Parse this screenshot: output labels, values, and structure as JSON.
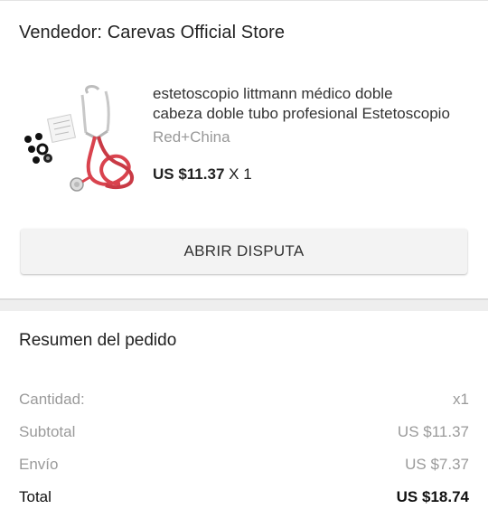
{
  "seller": {
    "label": "Vendedor: Carevas Official Store"
  },
  "product": {
    "title_line1": "estetoscopio littmann médico doble",
    "title_line2": "cabeza doble tubo profesional Estetoscopio",
    "variant": "Red+China",
    "price": "US $11.37",
    "quantity": "X 1",
    "image_icon": "stethoscope-product-image"
  },
  "dispute_button": {
    "label": "ABRIR DISPUTA"
  },
  "summary": {
    "title": "Resumen del pedido",
    "rows": [
      {
        "label": "Cantidad:",
        "value": "x1"
      },
      {
        "label": "Subtotal",
        "value": "US $11.37"
      },
      {
        "label": "Envío",
        "value": "US $7.37"
      }
    ],
    "total": {
      "label": "Total",
      "value": "US $18.74"
    }
  },
  "colors": {
    "tube_red": "#d9434e",
    "text_gray": "#999999",
    "button_bg": "#f3f3f3"
  }
}
